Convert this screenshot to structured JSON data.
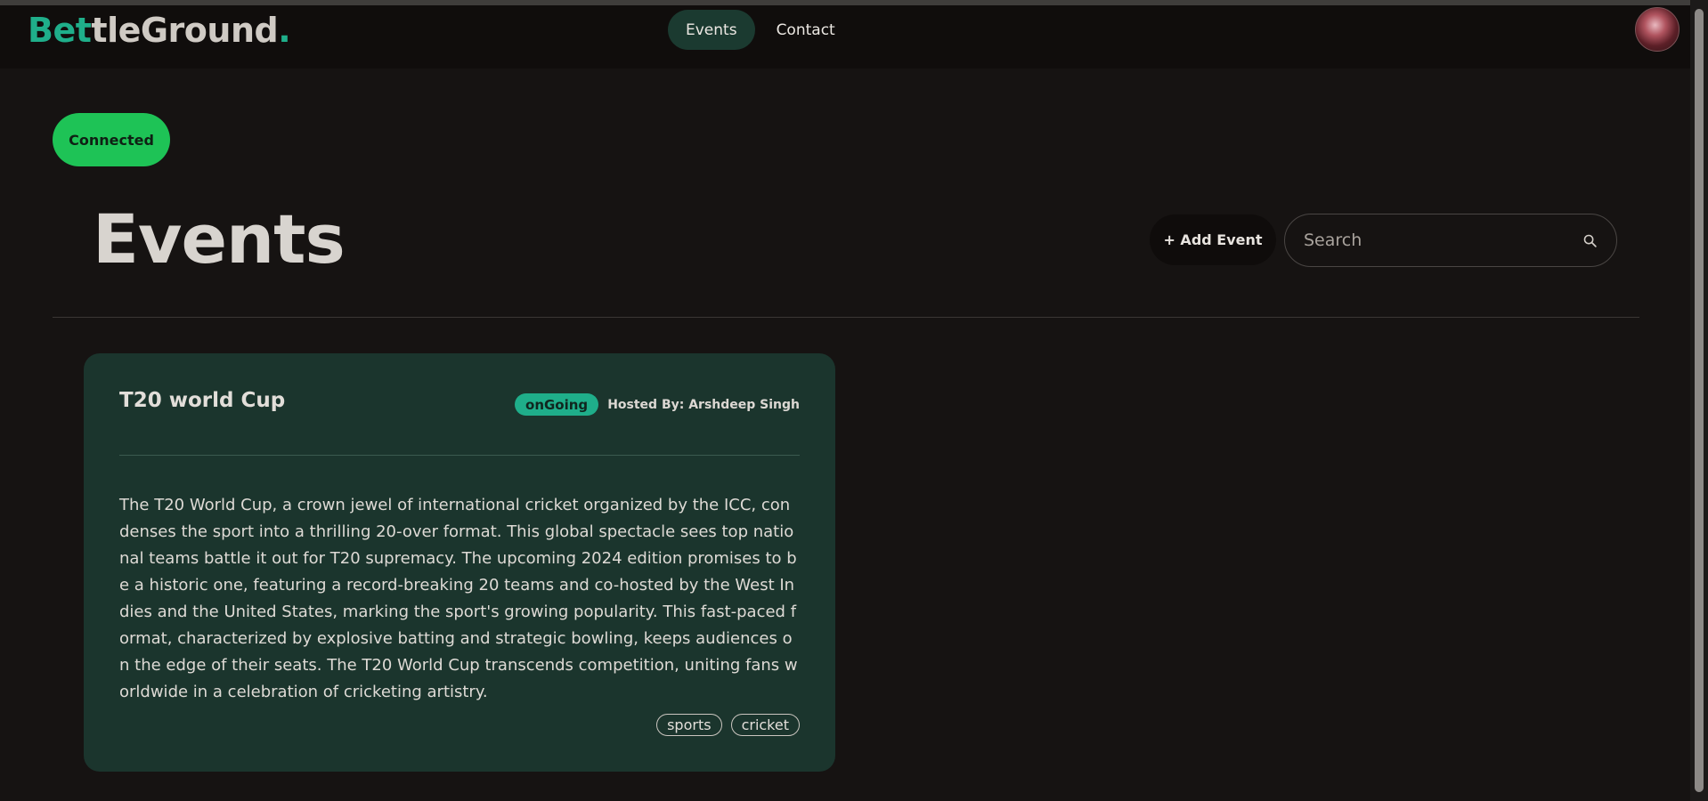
{
  "brand": {
    "accent": "Bet",
    "rest": "tleGround",
    "dot": ".",
    "accent_color": "#1fae8a"
  },
  "nav": {
    "items": [
      {
        "label": "Events",
        "active": true
      },
      {
        "label": "Contact",
        "active": false
      }
    ]
  },
  "user": {
    "avatar_icon": "user-avatar"
  },
  "connection": {
    "status": "Connected",
    "color": "#1ec356"
  },
  "page": {
    "title": "Events"
  },
  "toolbar": {
    "add_event_label": "+ Add Event",
    "search_placeholder": "Search",
    "search_value": "",
    "search_icon": "search-icon"
  },
  "events": [
    {
      "title": "T20 world Cup",
      "status": "onGoing",
      "status_color": "#1fae8a",
      "host": "Hosted By: Arshdeep Singh",
      "description": "The T20 World Cup, a crown jewel of international cricket organized by the ICC, condenses the sport into a thrilling 20-over format. This global spectacle sees top national teams battle it out for T20 supremacy. The upcoming 2024 edition promises to be a historic one, featuring a record-breaking 20 teams and co-hosted by the West Indies and the United States, marking the sport's growing popularity. This fast-paced format, characterized by explosive batting and strategic bowling, keeps audiences on the edge of their seats. The T20 World Cup transcends competition, uniting fans worldwide in a celebration of cricketing artistry.",
      "tags": [
        "sports",
        "cricket"
      ]
    }
  ]
}
